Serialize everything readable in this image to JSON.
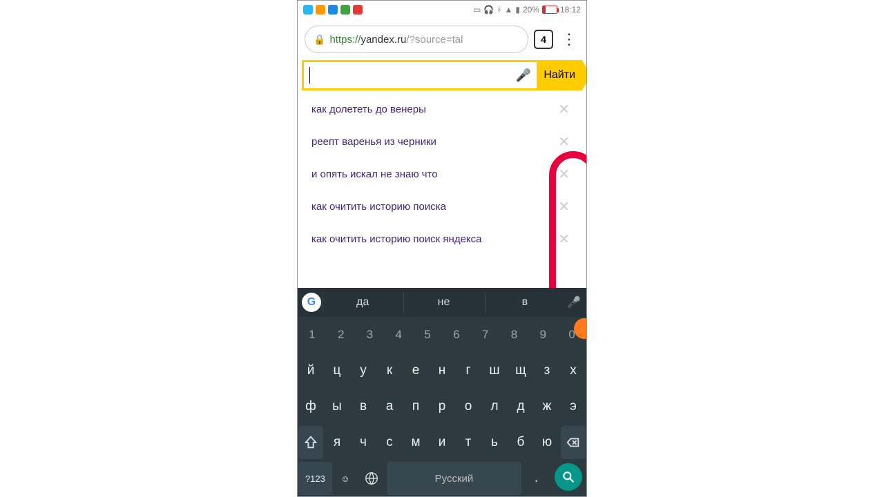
{
  "status": {
    "battery_pct": "20%",
    "time": "18:12"
  },
  "browser": {
    "url_https": "https://",
    "url_domain": "yandex.ru",
    "url_path": "/?source=tal",
    "tab_count": "4"
  },
  "search": {
    "button_label": "Найти"
  },
  "suggestions": [
    "как долететь до венеры",
    "реепт варенья из черники",
    "и опять искал не знаю что",
    "как очитить историю поиска",
    "как очитить историю поиск яндекса"
  ],
  "keyboard": {
    "word_suggestions": [
      "да",
      "не",
      "в"
    ],
    "row_num": [
      "1",
      "2",
      "3",
      "4",
      "5",
      "6",
      "7",
      "8",
      "9",
      "0"
    ],
    "row1": [
      "й",
      "ц",
      "у",
      "к",
      "е",
      "н",
      "г",
      "ш",
      "щ",
      "з",
      "х"
    ],
    "row2": [
      "ф",
      "ы",
      "в",
      "а",
      "п",
      "р",
      "о",
      "л",
      "д",
      "ж",
      "э"
    ],
    "row3": [
      "я",
      "ч",
      "с",
      "м",
      "и",
      "т",
      "ь",
      "б",
      "ю"
    ],
    "symbols_key": "?123",
    "space_label": "Русский",
    "dot_key": ".",
    "emoji_key": "☺",
    "comma_key": ","
  }
}
